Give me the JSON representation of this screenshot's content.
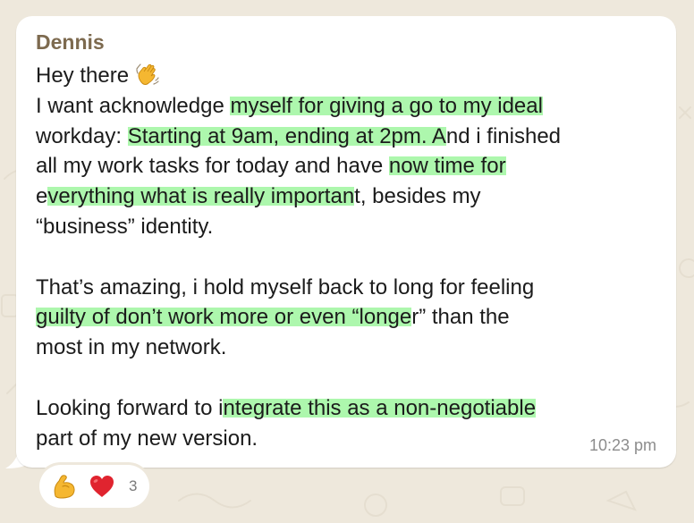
{
  "message": {
    "sender": "Dennis",
    "lines": [
      [
        {
          "t": "Hey there ",
          "hl": false
        }
      ],
      [
        {
          "t": "I want acknowledge ",
          "hl": false
        },
        {
          "t": "myself for giving a go to my ideal",
          "hl": true
        }
      ],
      [
        {
          "t": "workday: ",
          "hl": false
        },
        {
          "t": "Starting at 9am, ending at 2pm. A",
          "hl": true
        },
        {
          "t": "nd i finished",
          "hl": false
        }
      ],
      [
        {
          "t": "all my work tasks for today and have ",
          "hl": false
        },
        {
          "t": "now time for",
          "hl": true
        }
      ],
      [
        {
          "t": "e",
          "hl": false
        },
        {
          "t": "verything what is really importan",
          "hl": true
        },
        {
          "t": "t, besides my",
          "hl": false
        }
      ],
      [
        {
          "t": "“business” identity.",
          "hl": false
        }
      ],
      [],
      [
        {
          "t": "That’s amazing, i hold myself back to long for feeling",
          "hl": false
        }
      ],
      [
        {
          "t": "guilty of don’t work more or even “longe",
          "hl": true
        },
        {
          "t": "r” than the",
          "hl": false
        }
      ],
      [
        {
          "t": "most in my network.",
          "hl": false
        }
      ],
      [],
      [
        {
          "t": "Looking forward to i",
          "hl": false
        },
        {
          "t": "ntegrate this as a non-negotiable",
          "hl": true
        }
      ],
      [
        {
          "t": "part of my new version.",
          "hl": false
        }
      ]
    ],
    "wave_emoji": "waving-hand",
    "time": "10:23 pm"
  },
  "reactions": {
    "items": [
      {
        "icon": "flexed-biceps",
        "color": "#f5b731"
      },
      {
        "icon": "red-heart",
        "color": "#e0242f"
      }
    ],
    "count": "3"
  },
  "colors": {
    "background": "#eee8dc",
    "bubble": "#ffffff",
    "sender": "#7d6a4f",
    "highlight": "#96f596",
    "timestamp": "#8c8c8c"
  }
}
